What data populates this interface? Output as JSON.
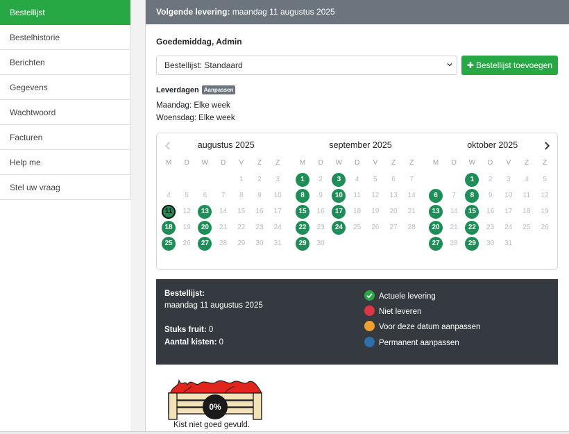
{
  "sidebar": {
    "items": [
      {
        "label": "Bestellijst",
        "active": true
      },
      {
        "label": "Bestelhistorie"
      },
      {
        "label": "Berichten"
      },
      {
        "label": "Gegevens"
      },
      {
        "label": "Wachtwoord"
      },
      {
        "label": "Facturen"
      },
      {
        "label": "Help me"
      },
      {
        "label": "Stel uw vraag"
      }
    ]
  },
  "topbar": {
    "label": "Volgende levering:",
    "value": "maandag 11 augustus 2025"
  },
  "greeting": "Goedemiddag, Admin",
  "order_select": {
    "value": "Bestellijst: Standaard"
  },
  "add_button": {
    "icon": "plus-icon",
    "label": "Bestellijst toevoegen"
  },
  "delivery": {
    "title": "Leverdagen",
    "badge": "Aanpassen",
    "days": [
      "Maandag: Elke week",
      "Woensdag: Elke week"
    ]
  },
  "calendar": {
    "weekdays": [
      "M",
      "D",
      "W",
      "D",
      "V",
      "Z",
      "Z"
    ],
    "months": [
      {
        "title": "augustus 2025",
        "offset": 4,
        "days": 31,
        "delivery": [
          11,
          13,
          18,
          20,
          25,
          27
        ],
        "today": 11
      },
      {
        "title": "september 2025",
        "offset": 0,
        "days": 30,
        "delivery": [
          1,
          3,
          8,
          10,
          15,
          17,
          22,
          24,
          29
        ],
        "today": null
      },
      {
        "title": "oktober 2025",
        "offset": 2,
        "days": 31,
        "delivery": [
          1,
          6,
          8,
          13,
          15,
          20,
          22,
          27,
          29
        ],
        "today": null
      }
    ]
  },
  "summary": {
    "list_label": "Bestellijst:",
    "list_date": "maandag 11 augustus 2025",
    "fruit_label": "Stuks fruit:",
    "fruit_value": "0",
    "crates_label": "Aantal kisten:",
    "crates_value": "0"
  },
  "legend": [
    {
      "label": "Actuele levering",
      "color": "#28a745",
      "icon": "check-icon"
    },
    {
      "label": "Niet leveren",
      "color": "#dc3545"
    },
    {
      "label": "Voor deze datum aanpassen",
      "color": "#f0a030"
    },
    {
      "label": "Permanent aanpassen",
      "color": "#2f6faa"
    }
  ],
  "crate": {
    "fill_percent_label": "0%",
    "fill_fraction": 0,
    "caption": "Kist niet goed gevuld."
  }
}
